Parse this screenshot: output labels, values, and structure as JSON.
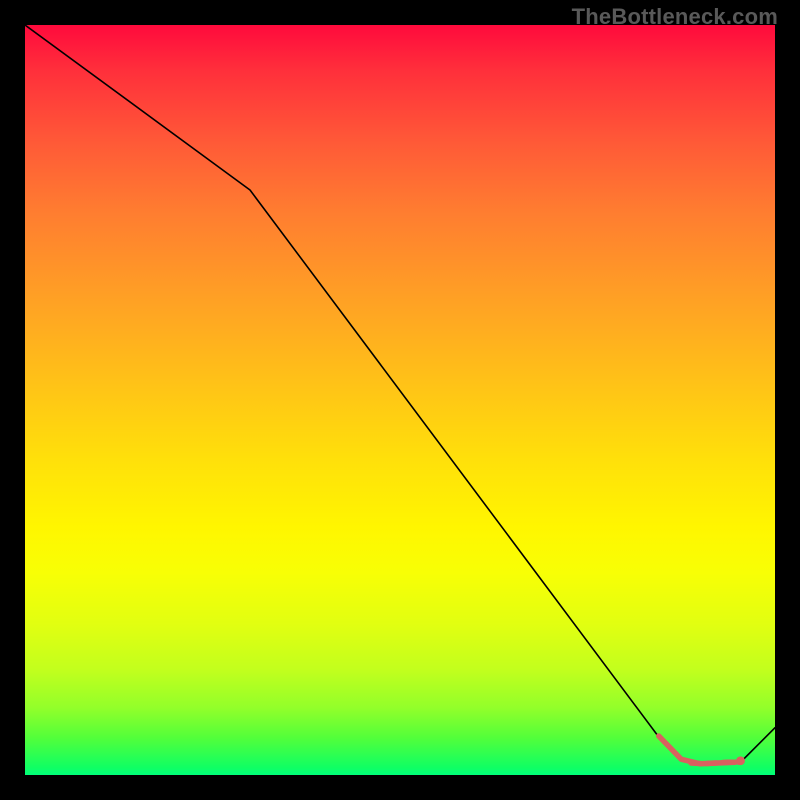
{
  "watermark": "TheBottleneck.com",
  "chart_data": {
    "type": "line",
    "title": "",
    "xlabel": "",
    "ylabel": "",
    "xlim": [
      0,
      100
    ],
    "ylim": [
      0,
      100
    ],
    "grid": false,
    "series": [
      {
        "name": "main-curve",
        "x": [
          0,
          30,
          85,
          87,
          90,
          92.6,
          95.4,
          100
        ],
        "y": [
          100,
          78,
          4.4,
          2.4,
          1.4,
          1.7,
          1.7,
          6.3
        ],
        "stroke": "#000000",
        "width": 1.6
      },
      {
        "name": "highlight-segment",
        "x": [
          84.5,
          87.5,
          90.0,
          94.7
        ],
        "y": [
          5.2,
          2.1,
          1.5,
          1.7
        ],
        "stroke": "#d9615f",
        "width": 5.5
      },
      {
        "name": "highlight-dashes",
        "x": [
          88.8,
          90.5,
          92.1,
          93.7,
          95.4
        ],
        "y": [
          1.6,
          1.5,
          1.6,
          1.7,
          1.7
        ],
        "stroke": "#d9615f",
        "width": 5.5,
        "dash": [
          9,
          7
        ]
      },
      {
        "name": "highlight-dot",
        "x": [
          95.4
        ],
        "y": [
          1.9
        ],
        "stroke": "#d9615f",
        "r": 4.4
      }
    ],
    "background_gradient": [
      "#ff0a3c",
      "#ff2f3b",
      "#ff5b37",
      "#ff7d30",
      "#ffa224",
      "#ffc317",
      "#ffe00a",
      "#fff600",
      "#f8ff05",
      "#e1ff11",
      "#c2ff1d",
      "#93ff2a",
      "#53ff3a",
      "#10ff63",
      "#00ff7a"
    ]
  }
}
